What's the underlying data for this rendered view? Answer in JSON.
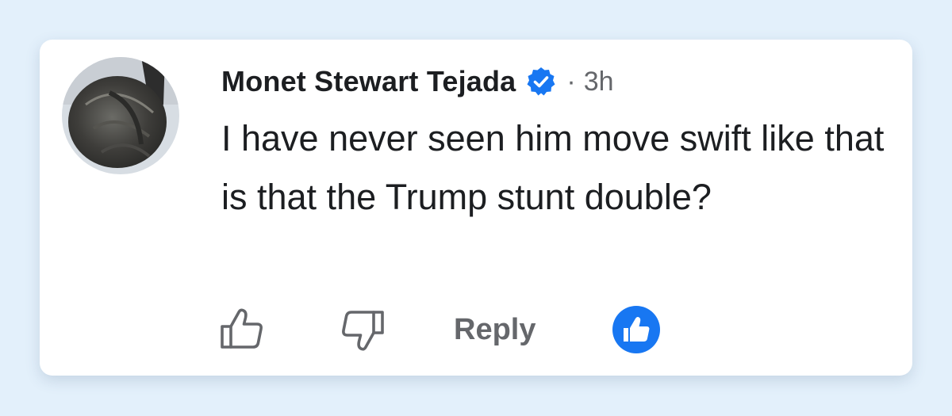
{
  "comment": {
    "author": "Monet Stewart Tejada",
    "verified_icon": "verified-badge-icon",
    "separator": "·",
    "timestamp": "3h",
    "text": "I have never seen him move swift like that is that the Trump stunt double?",
    "actions": {
      "like_icon": "thumbs-up-outline-icon",
      "dislike_icon": "thumbs-down-outline-icon",
      "reply_label": "Reply",
      "reaction_icon": "like-reaction-icon"
    }
  },
  "colors": {
    "background": "#e3f0fb",
    "card": "#ffffff",
    "accent_blue": "#1877f2",
    "text_primary": "#1c1e21",
    "text_secondary": "#65676b"
  }
}
